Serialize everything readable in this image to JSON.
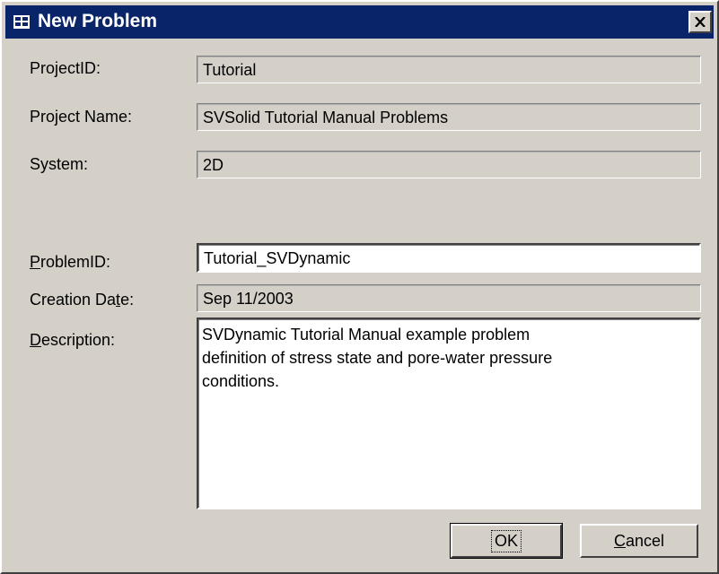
{
  "window": {
    "title": "New Problem",
    "close_icon": "close-icon"
  },
  "fields": {
    "project_id": {
      "label": "ProjectID:",
      "value": "Tutorial"
    },
    "project_name": {
      "label": "Project Name:",
      "value": "SVSolid Tutorial Manual Problems"
    },
    "system": {
      "label": "System:",
      "value": "2D"
    },
    "problem_id": {
      "label_pre": "",
      "label_ul": "P",
      "label_post": "roblemID:",
      "value": "Tutorial_SVDynamic"
    },
    "creation_date": {
      "label_pre": "Creation Da",
      "label_ul": "t",
      "label_post": "e:",
      "value": "Sep 11/2003"
    },
    "description": {
      "label_pre": "",
      "label_ul": "D",
      "label_post": "escription:",
      "value": "SVDynamic Tutorial Manual example problem\ndefinition of stress state and pore-water pressure\nconditions."
    }
  },
  "buttons": {
    "ok": {
      "label": "OK"
    },
    "cancel": {
      "label_ul": "C",
      "label_post": "ancel"
    }
  }
}
